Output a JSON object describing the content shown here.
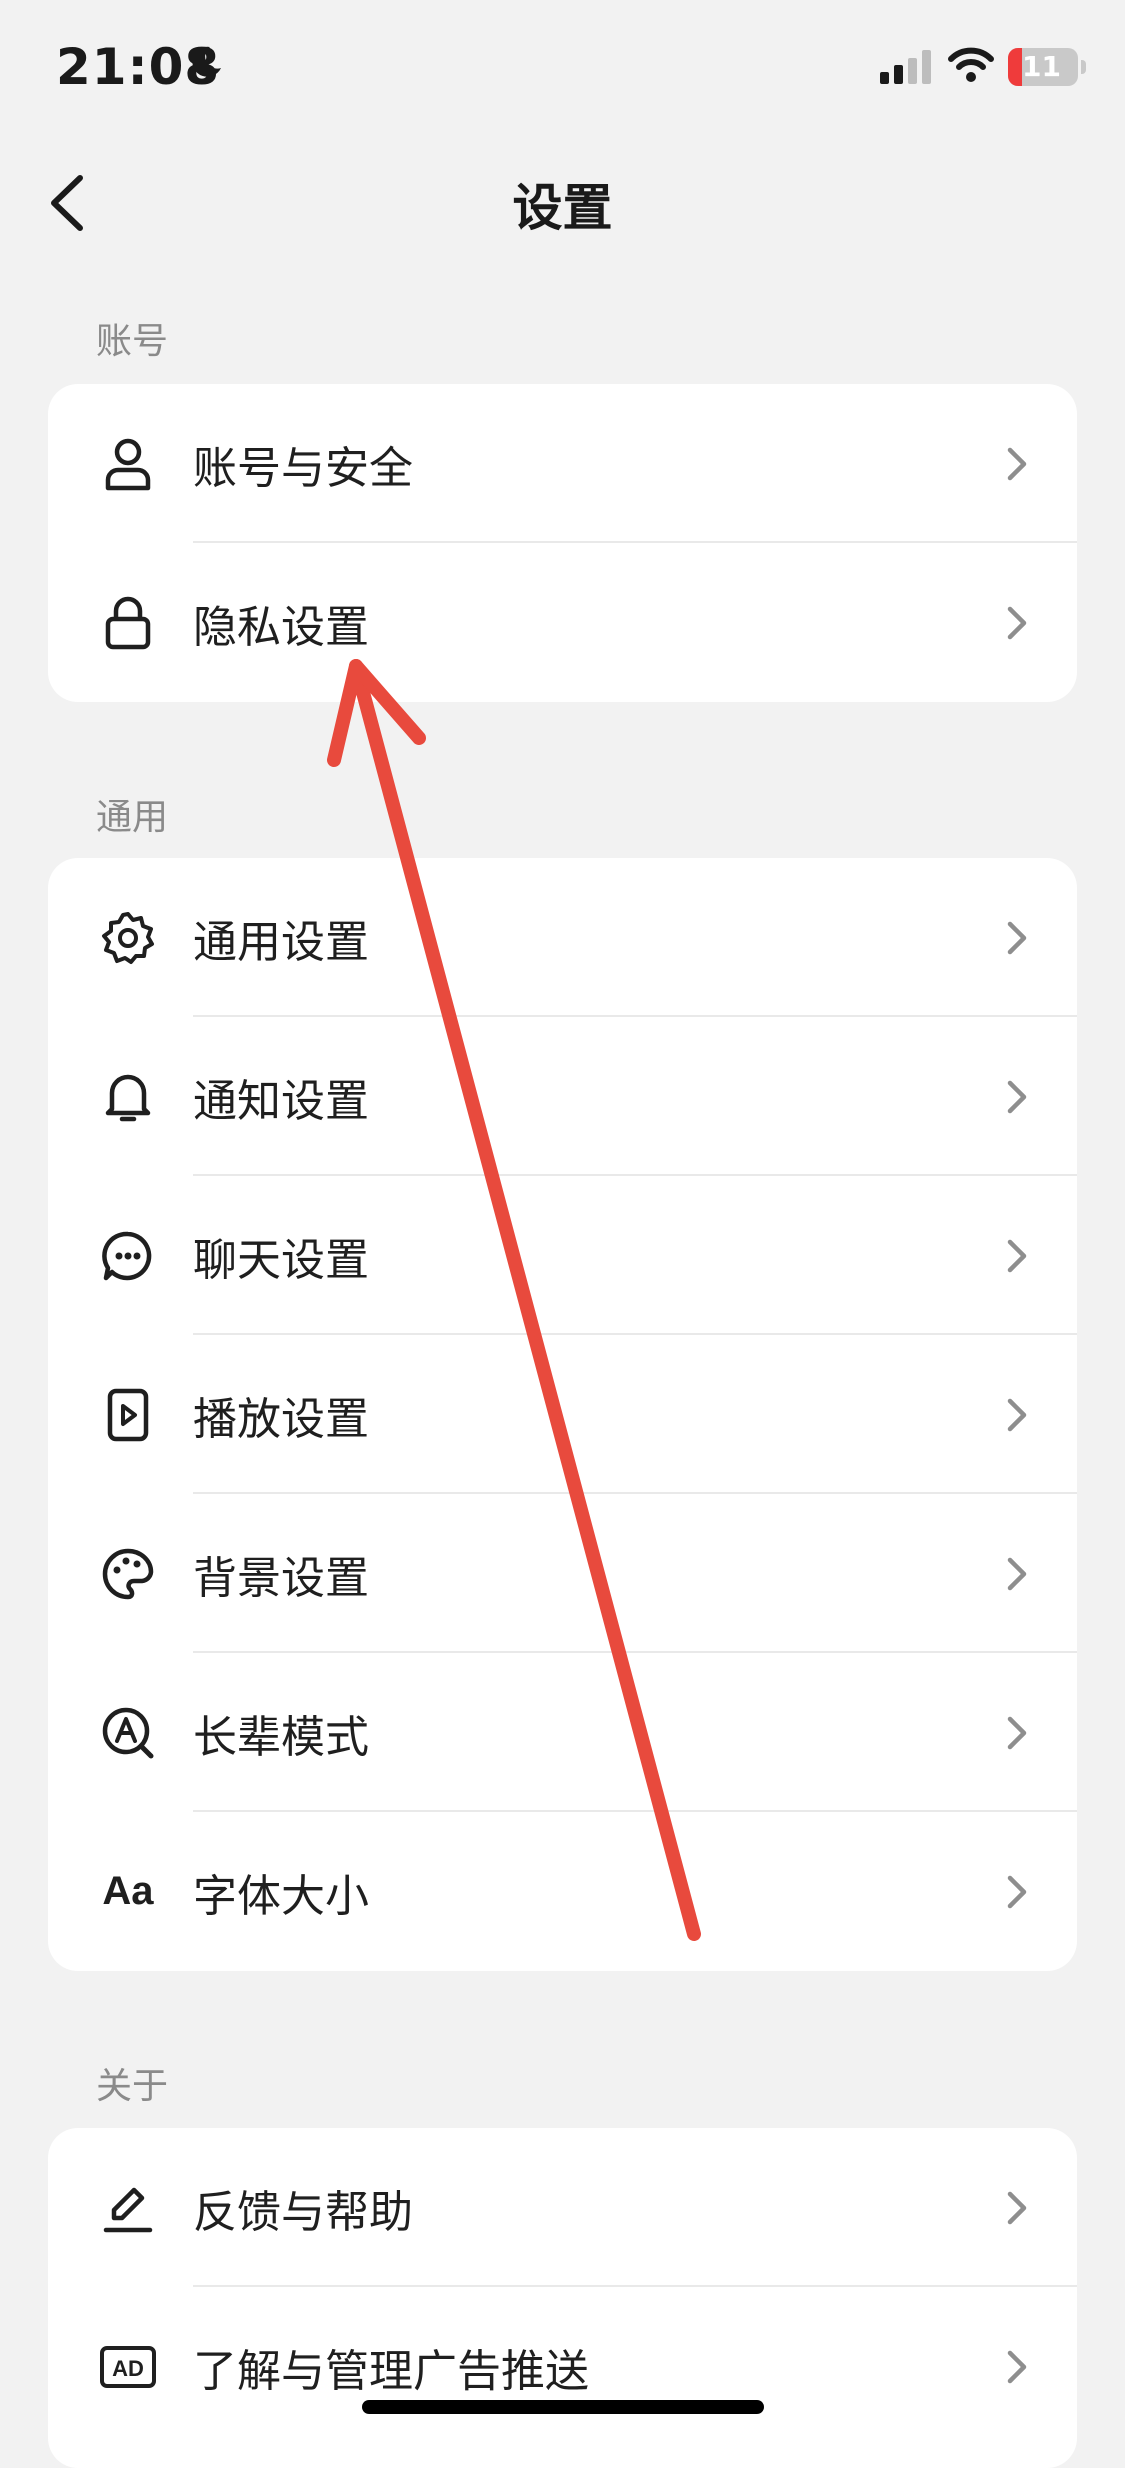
{
  "status_bar": {
    "time": "21:08",
    "battery": "11"
  },
  "header": {
    "title": "设置"
  },
  "sections": [
    {
      "label": "账号",
      "items": [
        {
          "label": "账号与安全",
          "icon": "person-icon"
        },
        {
          "label": "隐私设置",
          "icon": "lock-icon"
        }
      ]
    },
    {
      "label": "通用",
      "items": [
        {
          "label": "通用设置",
          "icon": "gear-icon"
        },
        {
          "label": "通知设置",
          "icon": "bell-icon"
        },
        {
          "label": "聊天设置",
          "icon": "chat-bubble-icon"
        },
        {
          "label": "播放设置",
          "icon": "play-icon"
        },
        {
          "label": "背景设置",
          "icon": "palette-icon"
        },
        {
          "label": "长辈模式",
          "icon": "elder-mode-icon"
        },
        {
          "label": "字体大小",
          "icon": "font-size-icon",
          "icon_text": "Aa"
        }
      ]
    },
    {
      "label": "关于",
      "items": [
        {
          "label": "反馈与帮助",
          "icon": "edit-pen-icon"
        },
        {
          "label": "了解与管理广告推送",
          "icon": "ad-icon",
          "icon_text": "AD"
        }
      ]
    }
  ],
  "annotation": {
    "color": "#e84a3d",
    "icon": "red-arrow-annotation"
  },
  "colors": {
    "background": "#f2f2f2",
    "card": "#ffffff",
    "section_label": "#8a8a8a"
  }
}
